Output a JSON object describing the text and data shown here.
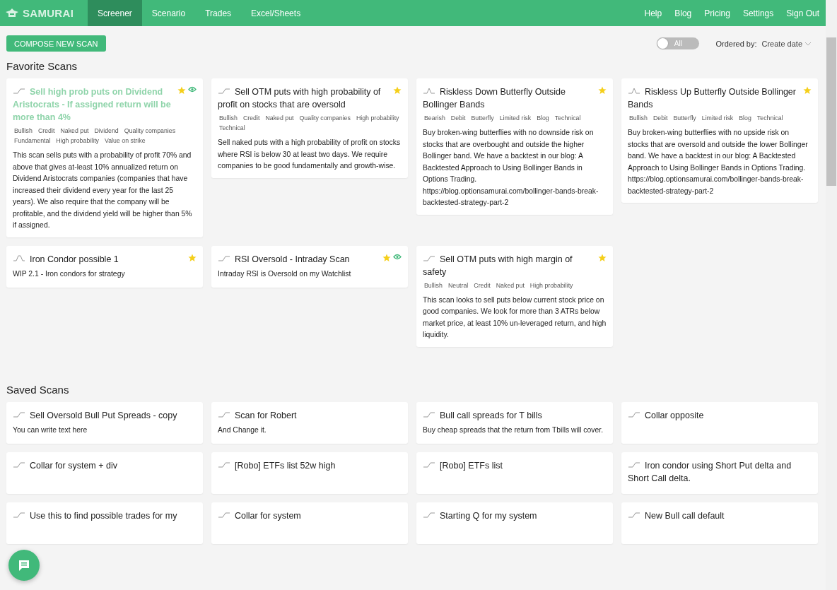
{
  "brand": "SAMURAI",
  "nav": [
    {
      "label": "Screener",
      "selected": true
    },
    {
      "label": "Scenario",
      "selected": false
    },
    {
      "label": "Trades",
      "selected": false
    },
    {
      "label": "Excel/Sheets",
      "selected": false
    }
  ],
  "nav_right": [
    "Help",
    "Blog",
    "Pricing",
    "Settings",
    "Sign Out"
  ],
  "compose_button": "COMPOSE NEW SCAN",
  "toggle": {
    "label": "All",
    "on": false
  },
  "order": {
    "label": "Ordered by:",
    "value": "Create date"
  },
  "sections": [
    {
      "title": "Favorite Scans",
      "cards": [
        {
          "kind": "ramp",
          "title": "Sell high prob puts on Dividend Aristocrats - If assigned return will be more than 4%",
          "selected": true,
          "favorite": true,
          "watched": true,
          "tags": [
            "Bullish",
            "Credit",
            "Naked put",
            "Dividend",
            "Quality companies",
            "Fundamental",
            "High probability",
            "Value on strike"
          ],
          "description": "This scan sells puts with a probability of profit 70% and above that gives at-least 10% annualized return on Dividend Aristocrats companies (companies that have increased their dividend every year for the last 25 years). We also require that the company will be profitable, and the dividend yield will be higher than 5% if assigned."
        },
        {
          "kind": "ramp",
          "title": "Sell OTM puts with high probability of profit on stocks that are oversold",
          "selected": false,
          "favorite": true,
          "watched": false,
          "tags": [
            "Bullish",
            "Credit",
            "Naked put",
            "Quality companies",
            "High probability",
            "Technical"
          ],
          "description": "Sell naked puts with a high probability of profit on stocks where RSI is below 30 at least two days. We require companies to be good fundamentally and growth-wise."
        },
        {
          "kind": "peak",
          "title": "Riskless Down Butterfly Outside Bollinger Bands",
          "selected": false,
          "favorite": true,
          "watched": false,
          "tags": [
            "Bearish",
            "Debit",
            "Butterfly",
            "Limited risk",
            "Blog",
            "Technical"
          ],
          "description": "Buy broken-wing butterflies with no downside risk on stocks that are overbought and outside the higher Bollinger band. We have a backtest in our blog: A Backtested Approach to Using Bollinger Bands in Options Trading. https://blog.optionsamurai.com/bollinger-bands-break-backtested-strategy-part-2"
        },
        {
          "kind": "peak",
          "title": "Riskless Up Butterfly Outside Bollinger Bands",
          "selected": false,
          "favorite": true,
          "watched": false,
          "tags": [
            "Bullish",
            "Debit",
            "Butterfly",
            "Limited risk",
            "Blog",
            "Technical"
          ],
          "description": "Buy broken-wing butterflies with no upside risk on stocks that are oversold and outside the lower Bollinger band. We have a backtest in our blog: A Backtested Approach to Using Bollinger Bands in Options Trading. https://blog.optionsamurai.com/bollinger-bands-break-backtested-strategy-part-2"
        },
        {
          "kind": "plateau",
          "title": "Iron Condor possible 1",
          "selected": false,
          "favorite": true,
          "watched": false,
          "description": "WIP 2.1 - Iron condors for strategy"
        },
        {
          "kind": "ramp",
          "title": "RSI Oversold - Intraday Scan",
          "selected": false,
          "favorite": true,
          "watched": true,
          "description": "Intraday RSI is Oversold on my Watchlist"
        },
        {
          "kind": "ramp",
          "title": "Sell OTM puts with high margin of safety",
          "selected": false,
          "favorite": true,
          "watched": false,
          "tags": [
            "Bullish",
            "Neutral",
            "Credit",
            "Naked put",
            "High probability"
          ],
          "description": "This scan looks to sell puts below current stock price on good companies. We look for more than 3 ATRs below market price, at least 10% un-leveraged return, and high liquidity."
        }
      ]
    },
    {
      "title": "Saved Scans",
      "cards": [
        {
          "kind": "ramp",
          "title": "Sell Oversold Bull Put Spreads - copy",
          "selected": false,
          "favorite": false,
          "watched": false,
          "description": "You can write text here"
        },
        {
          "kind": "ramp",
          "title": "Scan for Robert",
          "selected": false,
          "favorite": false,
          "watched": false,
          "description": "And Change it."
        },
        {
          "kind": "ramp",
          "title": "Bull call spreads for T bills",
          "selected": false,
          "favorite": false,
          "watched": false,
          "description": "Buy cheap spreads that the return from Tbills will cover."
        },
        {
          "kind": "ramp",
          "title": "Collar opposite",
          "selected": false,
          "favorite": false,
          "watched": false
        },
        {
          "kind": "ramp",
          "title": "Collar for system + div",
          "selected": false,
          "favorite": false,
          "watched": false
        },
        {
          "kind": "ramp",
          "title": "[Robo] ETFs list 52w high",
          "selected": false,
          "favorite": false,
          "watched": false
        },
        {
          "kind": "ramp",
          "title": "[Robo] ETFs list",
          "selected": false,
          "favorite": false,
          "watched": false
        },
        {
          "kind": "ramp",
          "title": "Iron condor using Short Put delta and Short Call delta.",
          "selected": false,
          "favorite": false,
          "watched": false
        },
        {
          "kind": "ramp",
          "title": "Use this to find possible trades for my",
          "selected": false,
          "favorite": false,
          "watched": false
        },
        {
          "kind": "ramp",
          "title": "Collar for system",
          "selected": false,
          "favorite": false,
          "watched": false
        },
        {
          "kind": "ramp",
          "title": "Starting Q for my system",
          "selected": false,
          "favorite": false,
          "watched": false
        },
        {
          "kind": "ramp",
          "title": "New Bull call default",
          "selected": false,
          "favorite": false,
          "watched": false
        }
      ]
    }
  ]
}
